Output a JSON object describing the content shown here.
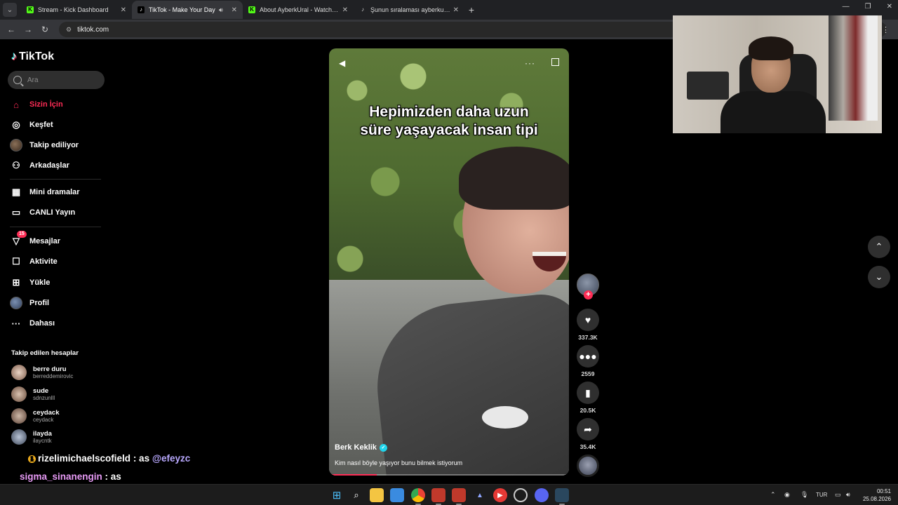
{
  "browser": {
    "tabs": [
      {
        "label": "Stream - Kick Dashboard",
        "active": false,
        "favicon": "kick-icon"
      },
      {
        "label": "TikTok - Make Your Day",
        "active": true,
        "favicon": "tiktok-icon"
      },
      {
        "label": "About AyberkUral - Watch Live",
        "active": false,
        "favicon": "kick-icon"
      },
      {
        "label": "Şunun sıralaması ayberkural | Y",
        "active": false,
        "favicon": "tiktok-icon"
      }
    ],
    "address": "tiktok.com"
  },
  "sidebar": {
    "logo": "TikTok",
    "search_placeholder": "Ara",
    "nav": [
      {
        "label": "Sizin İçin",
        "icon": "home-icon",
        "active": true
      },
      {
        "label": "Keşfet",
        "icon": "compass-icon"
      },
      {
        "label": "Takip ediliyor",
        "icon": "following-avatar-icon"
      },
      {
        "label": "Arkadaşlar",
        "icon": "friends-icon"
      },
      {
        "label": "Mini dramalar",
        "icon": "mini-drama-icon"
      },
      {
        "label": "CANLI Yayın",
        "icon": "live-icon"
      },
      {
        "label": "Mesajlar",
        "icon": "messages-icon",
        "badge": "15"
      },
      {
        "label": "Aktivite",
        "icon": "activity-icon"
      },
      {
        "label": "Yükle",
        "icon": "upload-icon"
      },
      {
        "label": "Profil",
        "icon": "profile-avatar-icon"
      },
      {
        "label": "Dahası",
        "icon": "more-icon"
      }
    ],
    "following_title": "Takip edilen hesaplar",
    "following": [
      {
        "name": "berre duru",
        "username": "berreddemirovic"
      },
      {
        "name": "sude",
        "username": "sdnzunlll"
      },
      {
        "name": "ceydack",
        "username": "ceydack"
      },
      {
        "name": "ilayda",
        "username": "ilaycntk"
      }
    ]
  },
  "video": {
    "caption_line1": "Hepimizden daha uzun",
    "caption_line2": "süre yaşayacak insan tipi",
    "author": "Berk Keklik",
    "description": "Kim nasıl böyle yaşıyor bunu bilmek istiyorum",
    "progress": 0.2
  },
  "actions": {
    "likes": "337.3K",
    "comments": "2559",
    "saves": "20.5K",
    "shares": "35.4K"
  },
  "chat": [
    {
      "user": "rizelimichaelscofield",
      "message": " : as ",
      "mention": "@efeyzc"
    },
    {
      "user": "sigma_sinanengin",
      "message": " : as"
    }
  ],
  "taskbar": {
    "language": "TUR",
    "time": "00:51",
    "date": "25.08.2026"
  },
  "colors": {
    "accent": "#fe2c55",
    "background": "#000000",
    "verified": "#20d5ec"
  }
}
